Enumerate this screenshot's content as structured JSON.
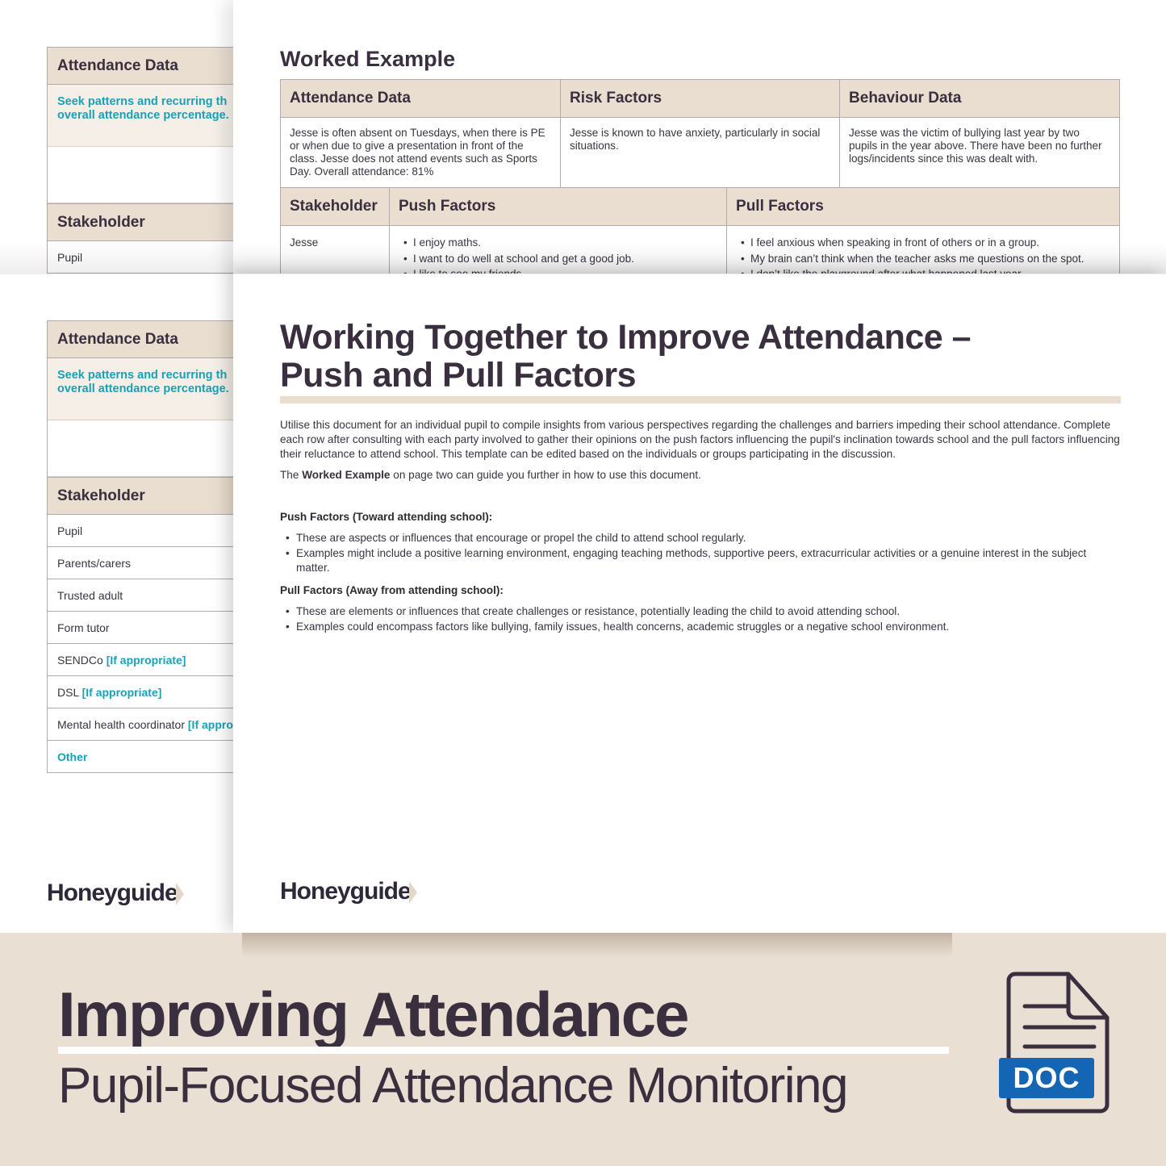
{
  "template_page": {
    "attendance_header": "Attendance Data",
    "attendance_hint_line1": "Seek patterns and recurring th",
    "attendance_hint_line2": "overall attendance percentage.",
    "stakeholder_header": "Stakeholder",
    "stakeholders": [
      {
        "name": "Pupil",
        "tag": ""
      },
      {
        "name": "Parents/carers",
        "tag": ""
      },
      {
        "name": "Trusted adult",
        "tag": ""
      },
      {
        "name": "Form tutor",
        "tag": ""
      },
      {
        "name": "SENDCo",
        "tag": "[If appropriate]"
      },
      {
        "name": "DSL",
        "tag": "[If appropriate]"
      },
      {
        "name": "Mental health coordinator",
        "tag": "[If approp"
      },
      {
        "name": "",
        "tag": "Other"
      }
    ]
  },
  "worked_example": {
    "title": "Worked Example",
    "headers": [
      "Attendance Data",
      "Risk Factors",
      "Behaviour Data"
    ],
    "cells": [
      "Jesse is often absent on Tuesdays, when there is PE or when due to give a presentation in front of the class. Jesse does not attend events such as Sports Day. Overall attendance: 81%",
      "Jesse is known to have anxiety, particularly in social situations.",
      "Jesse was the victim of bullying last year by two pupils in the year above. There have been no further logs/incidents since this was dealt with."
    ],
    "factor_headers": [
      "Stakeholder",
      "Push Factors",
      "Pull Factors"
    ],
    "stakeholder": "Jesse",
    "push_factors": [
      "I enjoy maths.",
      "I want to do well at school and get a good job.",
      "I like to see my friends."
    ],
    "pull_factors": [
      "I feel anxious when speaking in front of others or in a group.",
      "My brain can’t think when the teacher asks me questions on the spot.",
      "I don’t like the playground after what happened last year."
    ]
  },
  "main_page": {
    "title_line1": "Working Together to Improve Attendance –",
    "title_line2": "Push and Pull Factors",
    "intro": "Utilise this document for an individual pupil to compile insights from various perspectives regarding the challenges and barriers impeding their school attendance. Complete each row after consulting with each party involved to gather their opinions on the push factors influencing the pupil's inclination towards school and the pull factors influencing their reluctance to attend school. This template can be edited based on the individuals or groups participating in the discussion.",
    "guide_prefix": "The ",
    "guide_bold": "Worked Example",
    "guide_suffix": " on page two can guide you further in how to use this document.",
    "push_heading": "Push Factors (Toward attending school):",
    "push_points": [
      "These are aspects or influences that encourage or propel the child to attend school regularly.",
      "Examples might include a positive learning environment, engaging teaching methods, supportive peers, extracurricular activities or a genuine interest in the subject matter."
    ],
    "pull_heading": "Pull Factors (Away from attending school):",
    "pull_points": [
      "These are elements or influences that create challenges or resistance, potentially leading the child to avoid attending school.",
      "Examples could encompass factors like bullying, family issues, health concerns, academic struggles or a negative school environment."
    ]
  },
  "brand": {
    "logo": "Honeyguide"
  },
  "banner": {
    "title": "Improving Attendance",
    "subtitle": "Pupil-Focused Attendance Monitoring",
    "file_type": "DOC"
  },
  "colors": {
    "header_fill": "#e9ded0",
    "accent_teal": "#1aa1b6",
    "text_dark": "#3a2f3e",
    "doc_badge": "#1565b5",
    "banner_bg": "#e9dfd2"
  }
}
